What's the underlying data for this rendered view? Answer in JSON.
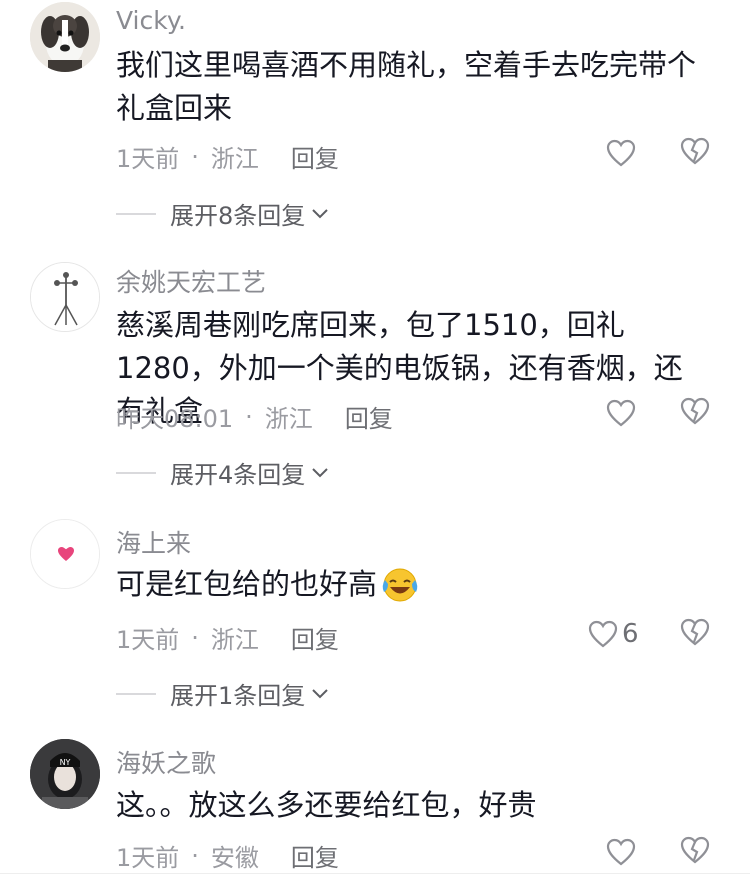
{
  "comments": [
    {
      "username": "Vicky.",
      "text": "我们这里喝喜酒不用随礼，空着手去吃完带个礼盒回来",
      "time": "1天前",
      "location": "浙江",
      "reply_label": "回复",
      "like_count": "",
      "expand_label": "展开8条回复",
      "avatar": "dog-avatar"
    },
    {
      "username": "余姚天宏工艺",
      "text": "慈溪周巷刚吃席回来，包了1510，回礼1280，外加一个美的电饭锅，还有香烟，还有礼盒",
      "time": "昨天08:01",
      "location": "浙江",
      "reply_label": "回复",
      "like_count": "",
      "expand_label": "展开4条回复",
      "avatar": "tripod-lamp-avatar"
    },
    {
      "username": "海上来",
      "text": "可是红包给的也好高",
      "time": "1天前",
      "location": "浙江",
      "reply_label": "回复",
      "like_count": "6",
      "expand_label": "展开1条回复",
      "avatar": "heart-avatar"
    },
    {
      "username": "海妖之歌",
      "text": "这。。放这么多还要给红包，好贵",
      "time": "1天前",
      "location": "安徽",
      "reply_label": "回复",
      "like_count": "",
      "expand_label": "",
      "avatar": "girl-avatar"
    }
  ],
  "dot": "·",
  "colors": {
    "text": "#161823",
    "meta": "#9a9ba1",
    "heart": "#e8457c"
  }
}
